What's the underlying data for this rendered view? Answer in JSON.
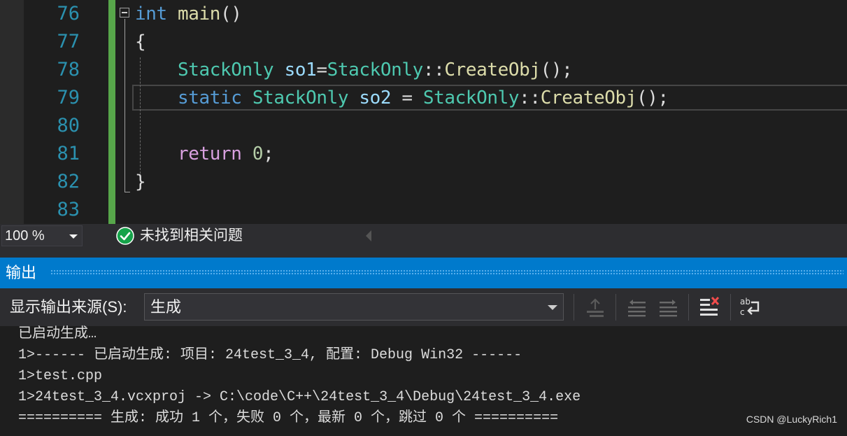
{
  "editor": {
    "line_numbers": [
      "76",
      "77",
      "78",
      "79",
      "80",
      "81",
      "82",
      "83"
    ],
    "code": {
      "l76": {
        "kw": "int",
        "fn": "main",
        "rest": "()"
      },
      "l77": {
        "brace": "{"
      },
      "l78": {
        "type1": "StackOnly",
        "var": "so1",
        "op": "=",
        "type2": "StackOnly",
        "sep": "::",
        "fn": "CreateObj",
        "rest": "();"
      },
      "l79": {
        "kw": "static",
        "type1": "StackOnly",
        "var": "so2",
        "op": " = ",
        "type2": "StackOnly",
        "sep": "::",
        "fn": "CreateObj",
        "rest": "();"
      },
      "l81": {
        "kw": "return",
        "num": "0",
        "rest": ";"
      },
      "l82": {
        "brace": "}"
      }
    }
  },
  "status_bar": {
    "zoom": "100 %",
    "issues_text": "未找到相关问题",
    "issues_icon": "check-circle-icon"
  },
  "output_panel": {
    "title": "输出",
    "source_label": "显示输出来源(S):",
    "source_value": "生成",
    "toolbar_icons": [
      "go-to-error-icon",
      "previous-message-icon",
      "next-message-icon",
      "clear-all-icon",
      "word-wrap-icon"
    ],
    "lines": [
      "已启动生成…",
      "1>------ 已启动生成: 项目: 24test_3_4, 配置: Debug Win32 ------",
      "1>test.cpp",
      "1>24test_3_4.vcxproj -> C:\\code\\C++\\24test_3_4\\Debug\\24test_3_4.exe",
      "========== 生成: 成功 1 个，失败 0 个，最新 0 个，跳过 0 个 =========="
    ]
  },
  "watermark": "CSDN @LuckyRich1",
  "colors": {
    "accent": "#007acc",
    "editor_bg": "#1e1e1e",
    "line_number": "#2b91af",
    "keyword": "#569cd6",
    "type": "#4ec9b0",
    "function": "#dcdcaa",
    "variable": "#9cdcfe",
    "change_bar": "#57a64a",
    "success": "#16a34a"
  }
}
